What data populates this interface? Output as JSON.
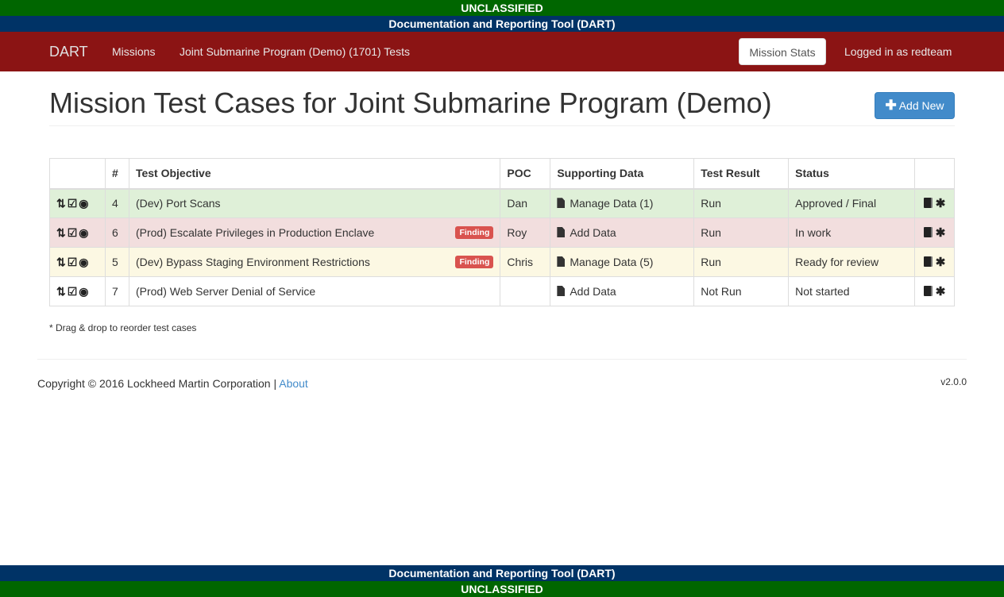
{
  "banners": {
    "classification": "UNCLASSIFIED",
    "app_name": "Documentation and Reporting Tool (DART)"
  },
  "navbar": {
    "brand": "DART",
    "missions": "Missions",
    "tests_link": "Joint Submarine Program (Demo) (1701) Tests",
    "mission_stats": "Mission Stats",
    "logged_in": "Logged in as redteam"
  },
  "header": {
    "title": "Mission Test Cases for Joint Submarine Program (Demo)",
    "add_new": "Add New"
  },
  "table": {
    "columns": [
      "",
      "#",
      "Test Objective",
      "POC",
      "Supporting Data",
      "Test Result",
      "Status",
      ""
    ],
    "rows": [
      {
        "num": "4",
        "objective": "(Dev) Port Scans",
        "finding": "",
        "poc": "Dan",
        "data": "Manage Data (1)",
        "result": "Run",
        "status": "Approved / Final",
        "row_state": "success"
      },
      {
        "num": "6",
        "objective": "(Prod) Escalate Privileges in Production Enclave",
        "finding": "Finding",
        "poc": "Roy",
        "data": "Add Data",
        "result": "Run",
        "status": "In work",
        "row_state": "danger"
      },
      {
        "num": "5",
        "objective": "(Dev) Bypass Staging Environment Restrictions",
        "finding": "Finding",
        "poc": "Chris",
        "data": "Manage Data (5)",
        "result": "Run",
        "status": "Ready for review",
        "row_state": "warning"
      },
      {
        "num": "7",
        "objective": "(Prod) Web Server Denial of Service",
        "finding": "",
        "poc": "",
        "data": "Add Data",
        "result": "Not Run",
        "status": "Not started",
        "row_state": "default"
      }
    ],
    "row_icons": [
      "sort-icon",
      "edit-icon",
      "eye-icon"
    ],
    "action_icons": [
      "book-icon",
      "asterisk-icon"
    ]
  },
  "note": "* Drag & drop to reorder test cases",
  "footer": {
    "copyright": "Copyright © 2016 Lockheed Martin Corporation | ",
    "about": "About",
    "version": "v2.0.0"
  },
  "colors": {
    "classification_green": "#006600",
    "banner_blue": "#003366",
    "navbar_red": "#8b1414",
    "primary": "#428bca",
    "finding_red": "#d9534f"
  }
}
